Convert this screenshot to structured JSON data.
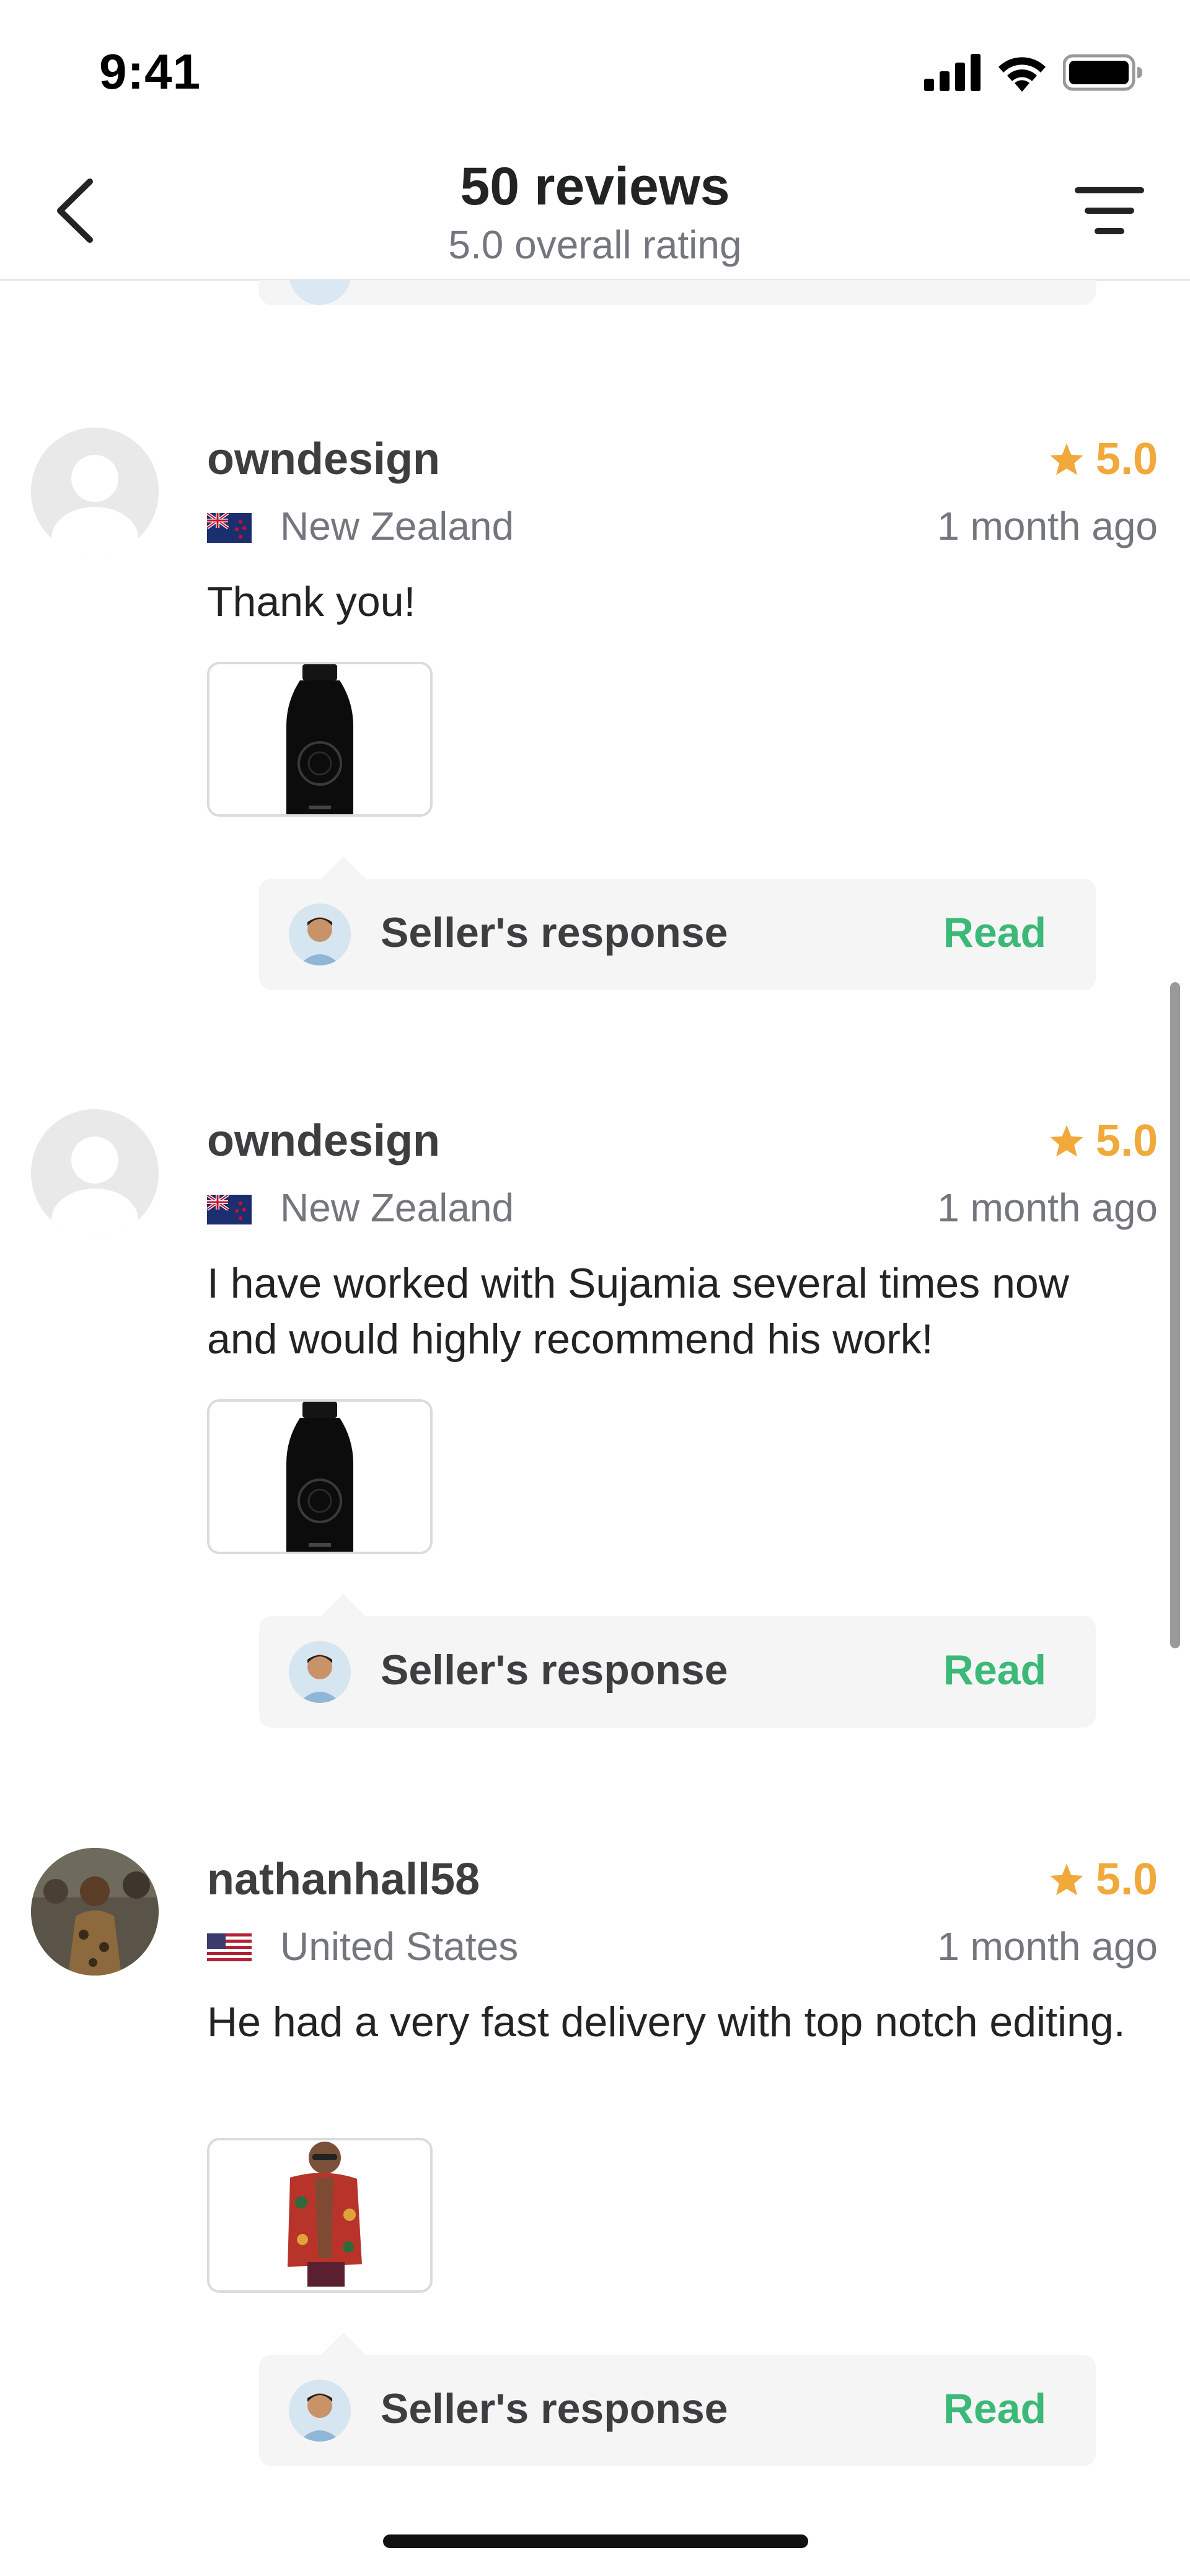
{
  "status_bar": {
    "time": "9:41"
  },
  "header": {
    "title": "50 reviews",
    "subtitle": "5.0 overall rating"
  },
  "colors": {
    "star": "#f0a93a",
    "read_link": "#3cb878",
    "response_bg": "#f5f5f5",
    "muted_text": "#74767e"
  },
  "reviews": [
    {
      "username": "owndesign",
      "rating": "5.0",
      "flag": "new-zealand-flag-icon",
      "country": "New Zealand",
      "time_ago": "1 month ago",
      "text": "Thank you!",
      "thumbnail": "black-bottle-product",
      "response_label": "Seller's response",
      "response_action": "Read"
    },
    {
      "username": "owndesign",
      "rating": "5.0",
      "flag": "new-zealand-flag-icon",
      "country": "New Zealand",
      "time_ago": "1 month ago",
      "text": "I have worked with Sujamia several times now and would highly recommend his work!",
      "thumbnail": "black-bottle-product",
      "response_label": "Seller's response",
      "response_action": "Read"
    },
    {
      "username": "nathanhall58",
      "rating": "5.0",
      "flag": "united-states-flag-icon",
      "country": "United States",
      "time_ago": "1 month ago",
      "text": "He had a very fast delivery with top notch editing.",
      "thumbnail": "man-in-floral-shirt",
      "response_label": "Seller's response",
      "response_action": "Read"
    }
  ]
}
